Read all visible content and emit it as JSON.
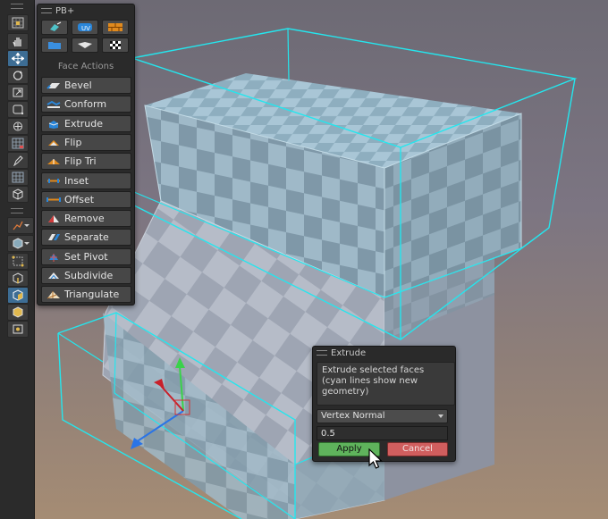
{
  "toolbar": {
    "tools": [
      {
        "icon": "grid-snap-icon",
        "active": false
      },
      {
        "icon": "hand-icon",
        "active": false
      },
      {
        "icon": "move-icon",
        "active": true
      },
      {
        "icon": "rotate-icon",
        "active": false
      },
      {
        "icon": "scale-icon",
        "active": false
      },
      {
        "icon": "rect-transform-icon",
        "active": false
      },
      {
        "icon": "transform-icon",
        "active": false
      },
      {
        "icon": "grid-icon",
        "active": false
      },
      {
        "icon": "pen-icon",
        "active": false
      },
      {
        "icon": "mesh-grid-icon",
        "active": false
      },
      {
        "icon": "cube-outline-icon",
        "active": false
      },
      {
        "icon": "edit-shape-icon",
        "active": false
      },
      {
        "icon": "cube-dropdown-icon",
        "active": false
      },
      {
        "icon": "vertex-select-icon",
        "active": false
      },
      {
        "icon": "edge-select-icon",
        "active": false
      },
      {
        "icon": "face-select-icon",
        "active": true
      },
      {
        "icon": "object-select-icon",
        "active": false
      },
      {
        "icon": "pivot-icon",
        "active": false
      }
    ]
  },
  "pb_panel": {
    "title": "PB+",
    "section_title": "Face Actions",
    "icon_buttons": [
      "shape-tool-icon",
      "uv-icon",
      "brick-icon",
      "folder-icon",
      "plane-icon",
      "checker-icon"
    ],
    "actions": [
      {
        "label": "Bevel",
        "icon": "bevel-icon"
      },
      {
        "label": "Conform",
        "icon": "conform-icon"
      },
      {
        "label": "Extrude",
        "icon": "extrude-icon"
      },
      {
        "label": "Flip",
        "icon": "flip-icon"
      },
      {
        "label": "Flip Tri",
        "icon": "flip-tri-icon"
      },
      {
        "label": "Inset",
        "icon": "inset-icon"
      },
      {
        "label": "Offset",
        "icon": "offset-icon"
      },
      {
        "label": "Remove",
        "icon": "remove-icon"
      },
      {
        "label": "Separate",
        "icon": "separate-icon"
      },
      {
        "label": "Set Pivot",
        "icon": "set-pivot-icon"
      },
      {
        "label": "Subdivide",
        "icon": "subdivide-icon"
      },
      {
        "label": "Triangulate",
        "icon": "triangulate-icon"
      }
    ]
  },
  "extrude_panel": {
    "title": "Extrude",
    "description": "Extrude selected faces (cyan lines show new geometry)",
    "mode_selected": "Vertex Normal",
    "distance": "0.5",
    "apply_label": "Apply",
    "cancel_label": "Cancel"
  },
  "colors": {
    "accent": "#3d6d94",
    "wireframe": "#24e6ee",
    "apply": "#5fb35c",
    "cancel": "#d05e5e"
  }
}
